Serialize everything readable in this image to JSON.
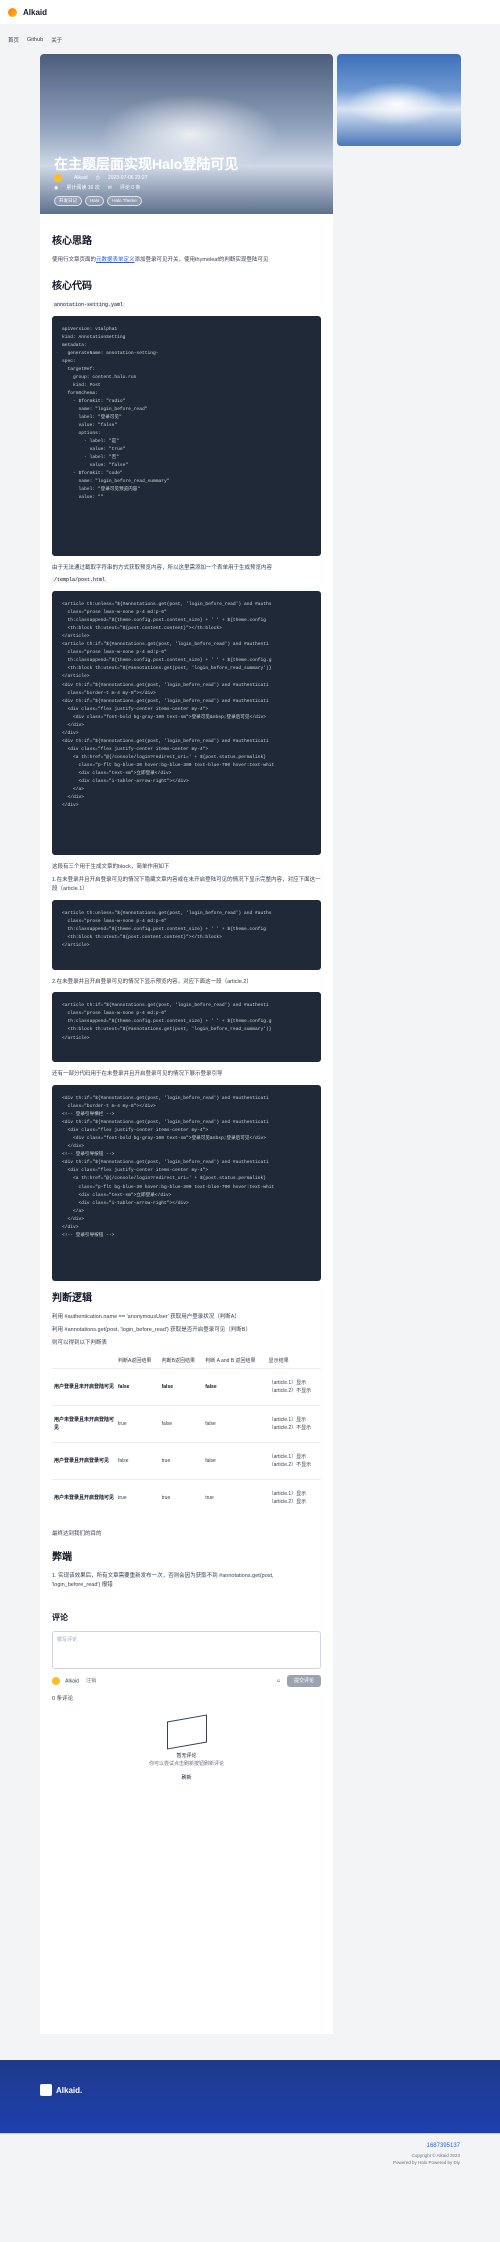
{
  "header": {
    "brand": "Alkaid"
  },
  "subnav": {
    "items": [
      "首页",
      "Github",
      "关于"
    ]
  },
  "hero": {
    "title": "在主题层面实现Halo登陆可见",
    "author": "Alkaid",
    "date": "2023-07-06 23:27",
    "stats": "累计阅读 16 次",
    "comments": "评论 0 条",
    "tags": [
      "开发日记",
      "Halo",
      "Halo Theme"
    ]
  },
  "article": {
    "h_idea": "核心思路",
    "p_idea_pre": "使用行文章页面的",
    "p_idea_link": "元数据表单定义",
    "p_idea_post": "添加登录可见开关，使用thymeleaf的判断实现登陆可见",
    "h_code": "核心代码",
    "file1": "annotation-setting.yaml",
    "code1": "apiVersion: v1alpha1\nkind: AnnotationSetting\nmetadata:\n  generateName: annotation-setting-\nspec:\n  targetRef:\n    group: content.halo.run\n    kind: Post\n  formSchema:\n    - $formkit: \"radio\"\n      name: \"login_before_read\"\n      label: \"登录可见\"\n      value: \"false\"\n      options:\n        - label: \"是\"\n          value: \"true\"\n        - label: \"否\"\n          value: \"false\"\n    - $formkit: \"code\"\n      name: \"login_before_read_summary\"\n      label: \"登录可见预览内容\"\n      value: \"\"",
    "p_after1": "由于无法通过截取字符串的方式获取预览内容，所以这里需添加一个表单用于生成预览内容",
    "file2": "/templa/post.html",
    "code2": "<article th:unless=\"${#annotations.get(post, 'login_before_read') and #auths\n  class=\"prose lmax-w-none p-4 md:p-6\"\n  th:classappend=\"${theme.config.post.content_size} + ' ' + ${theme.config\n  <th:block th:utext=\"${post.content.content}\"></th:block>\n</article>\n<article th:if=\"${#annotations.get(post, 'login_before_read') and #authenti\n  class=\"prose lmax-w-none p-4 md:p-6\"\n  th:classappend=\"${theme.config.post.content_size} + ' ' + ${theme.config.g\n  <th:block th:utext=\"${#annotations.get(post, 'login_before_read_summary')}\n</article>\n<div th:if=\"${#annotations.get(post, 'login_before_read') and #authenticati\n  class=\"border-t m-4 my-8\"></div>\n<div th:if=\"${#annotations.get(post, 'login_before_read') and #authenticati\n  <div class=\"flex justify-center items-center my-4\">\n    <div class=\"font-bold bg-gray-100 text-sm\">登录可见&nbsp;登录后可见</div>\n  </div>\n</div>\n<div th:if=\"${#annotations.get(post, 'login_before_read') and #authenticati\n  <div class=\"flex justify-center items-center my-4\">\n    <a th:href=\"@{/console/login?redirect_uri=' + ${post.status.permalink}\n      class=\"p-flt bg-blue-30 hover:bg-blue-300 text-blue-700 hover:text-whit\n      <div class=\"text-sm\">立即登录</div>\n      <div class=\"i-tabler-arrow-right\"></div>\n    </a>\n  </div>\n</div>",
    "p_three": "这段有三个用于生成文章的block，简单作用如下",
    "p_case1": "1.在未登录并且开启登录可见的情况下隐藏文章内容或在未开启登陆可见的情况下显示完整内容，对应下面这一段（article.1）",
    "code3": "<article th:unless=\"${#annotations.get(post, 'login_before_read') and #auths\n  class=\"prose lmax-w-none p-4 md:p-6\"\n  th:classappend=\"${theme.config.post.content_size} + ' ' + ${theme.config\n  <th:block th:utext=\"${post.content.content}\"></th:block>\n</article>",
    "p_case2": "2.在未登录并且开启登录可见的情况下显示预览内容，对应下面这一段（article.2）",
    "code4": "<article th:if=\"${#annotations.get(post, 'login_before_read') and #authenti\n  class=\"prose lmax-w-none p-4 md:p-6\"\n  th:classappend=\"${theme.config.post.content_size} + ' ' + ${theme.config.g\n  <th:block th:utext=\"${#annotations.get(post, 'login_before_read_summary')}\n</article>",
    "p_case3": "还有一部分代码用于在未登录并且开启登录可见的情况下展示登录引导",
    "code5": "<div th:if=\"${#annotations.get(post, 'login_before_read') and #authenticati\n  class=\"border-t m-4 my-8\"></div>\n<!-- 登录引导横栏 -->\n<div th:if=\"${#annotations.get(post, 'login_before_read') and #authenticati\n  <div class=\"flex justify-center items-center my-4\">\n    <div class=\"font-bold bg-gray-100 text-sm\">登录可见&nbsp;登录后可见</div>\n  </div>\n<!-- 登录引导按钮 -->\n<div th:if=\"${#annotations.get(post, 'login_before_read') and #authenticati\n  <div class=\"flex justify-center items-center my-4\">\n    <a th:href=\"@{/console/login?redirect_uri=' + ${post.status.permalink}\n      class=\"p-flt bg-blue-30 hover:bg-blue-300 text-blue-700 hover:text-whit\n      <div class=\"text-sm\">立即登录</div>\n      <div class=\"i-tabler-arrow-right\"></div>\n    </a>\n  </div>\n</div>\n<!-- 登录引导按钮 -->",
    "h_logic": "判断逻辑",
    "p_logic1": "利用 #authentication.name == 'anonymousUser' 获取用户登录状况（判断A）",
    "p_logic2": "利用 #annotations.get(post, 'login_before_read') 获取是否开启登录可见（判断B）",
    "p_logic3": "则可以得到以下判断表",
    "table_headers": [
      "",
      "判断A返回结果",
      "判断B返回结果",
      "判断 A and B 返回结果",
      "显示结果"
    ],
    "table_rows": [
      {
        "label": "用户登录且未开启登陆可见",
        "a": "false",
        "b": "false",
        "ab": "false",
        "result": "（article.1）显示\n（article.2）不显示"
      },
      {
        "label": "用户未登录且未开启登陆可见",
        "a": "true",
        "b": "false",
        "ab": "false",
        "result": "（article.1）显示\n（article.2）不显示"
      },
      {
        "label": "用户登录且开启登录可见",
        "a": "false",
        "b": "true",
        "ab": "false",
        "result": "（article.1）显示\n（article.2）不显示"
      },
      {
        "label": "用户未登录且开启登陆可见",
        "a": "true",
        "b": "true",
        "ab": "true",
        "result": "（article.1）显示\n（article.2）显示"
      }
    ],
    "p_done": "最终达到我们的目的",
    "h_cons": "弊端",
    "p_cons": "1. 实现该效果后，所有文章需要重新发布一次，否则会因为获取不到 #annotations.get(post, 'login_before_read') 报错"
  },
  "comments": {
    "title": "评论",
    "placeholder": "撰写评论",
    "user": "Alkaid",
    "logout": "注销",
    "submit": "提交评论",
    "count": "0 条评论",
    "empty_title": "暂无评论",
    "empty_desc": "你可以尝试点击刷新按钮刷新评论",
    "refresh": "刷新"
  },
  "footer": {
    "brand": "Alkaid.",
    "icp": "1687395137",
    "copyright": "Copyright © Alkaid 2023",
    "powered": "Powered by Halo  Powered by Diy"
  },
  "colors": {
    "footer_blue": "#1e3a8a",
    "link": "#2563eb",
    "code_bg": "#1f2937"
  }
}
